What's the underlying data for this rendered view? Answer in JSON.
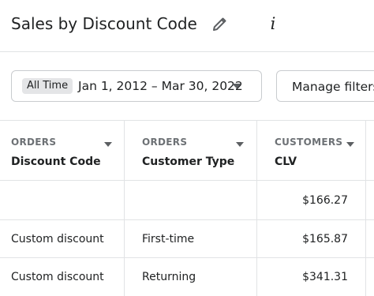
{
  "header": {
    "title": "Sales by Discount Code",
    "edit_icon": "pencil-icon",
    "info_icon": "info-icon",
    "info_glyph": "i"
  },
  "filters": {
    "range_badge": "All Time",
    "range_text": "Jan 1, 2012 – Mar 30, 2022",
    "manage_label": "Manage filters"
  },
  "table": {
    "columns": [
      {
        "group": "ORDERS",
        "name": "Discount Code"
      },
      {
        "group": "ORDERS",
        "name": "Customer Type"
      },
      {
        "group": "CUSTOMERS",
        "name": "CLV"
      }
    ],
    "summary": {
      "clv": "$166.27"
    },
    "rows": [
      {
        "discount_code": "Custom discount",
        "customer_type": "First-time",
        "clv": "$165.87"
      },
      {
        "discount_code": "Custom discount",
        "customer_type": "Returning",
        "clv": "$341.31"
      }
    ]
  },
  "colors": {
    "text": "#202223",
    "muted": "#6d7175",
    "border": "#e1e3e5",
    "badge_bg": "#e4e5e7"
  }
}
